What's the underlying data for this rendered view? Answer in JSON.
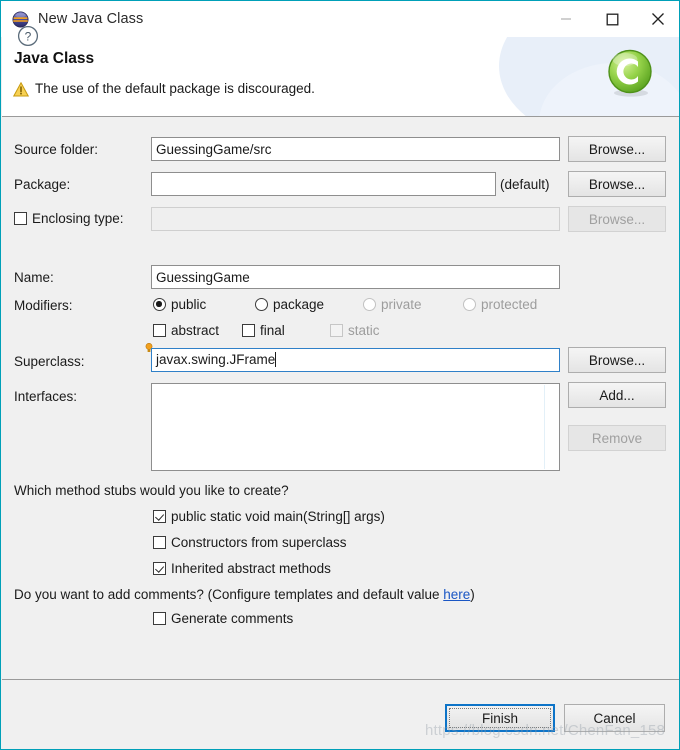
{
  "window": {
    "title": "New Java Class",
    "icon": "java-class-icon",
    "minimize_label": "minimize-icon",
    "maximize_label": "maximize-icon",
    "close_label": "close-icon"
  },
  "header": {
    "title": "Java Class",
    "message": "The use of the default package is discouraged.",
    "warning_icon": "warning-icon",
    "banner_icon": "java-class-banner-icon"
  },
  "form": {
    "source_folder": {
      "label": "Source folder:",
      "value": "GuessingGame/src",
      "browse_label": "Browse..."
    },
    "package": {
      "label": "Package:",
      "value": "",
      "suffix": "(default)",
      "browse_label": "Browse..."
    },
    "enclosing_type": {
      "label": "Enclosing type:",
      "checked": false,
      "value": "",
      "browse_label": "Browse...",
      "disabled": true
    },
    "name": {
      "label": "Name:",
      "value": "GuessingGame"
    },
    "modifiers": {
      "label": "Modifiers:",
      "radios": [
        {
          "label": "public",
          "selected": true,
          "disabled": false
        },
        {
          "label": "package",
          "selected": false,
          "disabled": false
        },
        {
          "label": "private",
          "selected": false,
          "disabled": true
        },
        {
          "label": "protected",
          "selected": false,
          "disabled": true
        }
      ],
      "checkboxes": [
        {
          "label": "abstract",
          "checked": false,
          "disabled": false
        },
        {
          "label": "final",
          "checked": false,
          "disabled": false
        },
        {
          "label": "static",
          "checked": false,
          "disabled": true
        }
      ]
    },
    "superclass": {
      "label": "Superclass:",
      "value": "javax.swing.JFrame",
      "browse_label": "Browse...",
      "focused": true,
      "hint_icon": "content-assist-bulb-icon"
    },
    "interfaces": {
      "label": "Interfaces:",
      "items": [],
      "add_label": "Add...",
      "remove_label": "Remove",
      "remove_disabled": true
    }
  },
  "stubs": {
    "question": "Which method stubs would you like to create?",
    "options": [
      {
        "label": "public static void main(String[] args)",
        "checked": true
      },
      {
        "label": "Constructors from superclass",
        "checked": false
      },
      {
        "label": "Inherited abstract methods",
        "checked": true
      }
    ]
  },
  "comments": {
    "question_prefix": "Do you want to add comments? (Configure templates and default value ",
    "link": "here",
    "question_suffix": ")",
    "option": {
      "label": "Generate comments",
      "checked": false
    }
  },
  "footer": {
    "help_label": "help-icon",
    "finish_label": "Finish",
    "cancel_label": "Cancel"
  },
  "watermark": "https://blog.csdn.net/ChenFan_158",
  "colors": {
    "dialog_border": "#00a0b8",
    "default_button_border": "#0d74c8",
    "link": "#1a56c4",
    "banner_green": "#7dc242"
  }
}
